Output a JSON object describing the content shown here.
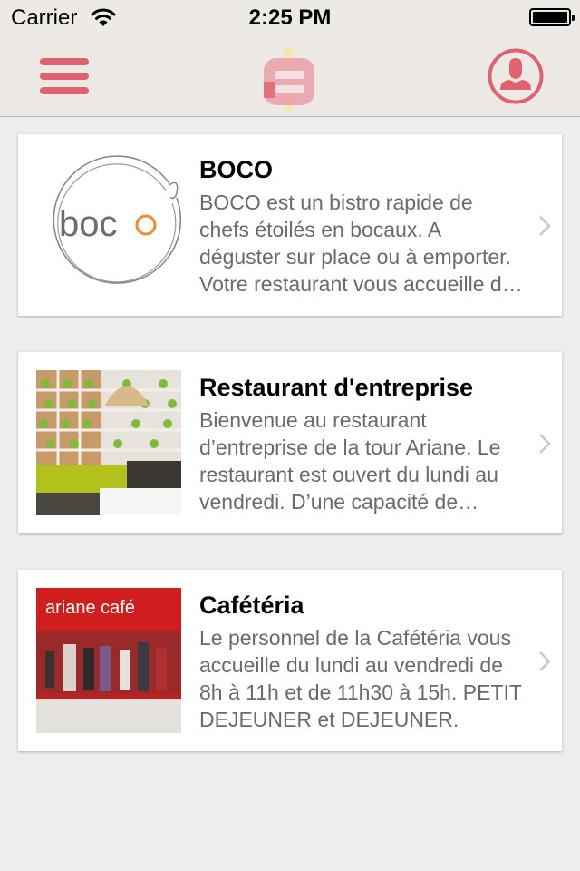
{
  "status_bar": {
    "carrier": "Carrier",
    "time": "2:25 PM"
  },
  "nav": {
    "menu_icon": "hamburger-icon",
    "profile_icon": "user-profile-icon"
  },
  "colors": {
    "accent": "#e0626f",
    "background": "#ededed",
    "bar": "#edeae6"
  },
  "restaurants": [
    {
      "name": "BOCO",
      "logo_text": "boco",
      "description": "BOCO est un bistro rapide de chefs étoilés en bocaux. A déguster sur place ou à emporter. Votre restaurant vous accueille du lundi au vendredi."
    },
    {
      "name": "Restaurant d'entreprise",
      "description": "Bienvenue au restaurant d’entreprise de la tour Ariane. Le restaurant est ouvert du lundi au vendredi. D’une capacité de plusieurs centaines de couverts."
    },
    {
      "name": "Cafétéria",
      "sign_text": "ariane café",
      "description": "Le personnel de la Cafétéria vous accueille du lundi au vendredi de 8h à 11h et de 11h30 à 15h. PETIT DEJEUNER et DEJEUNER."
    }
  ]
}
